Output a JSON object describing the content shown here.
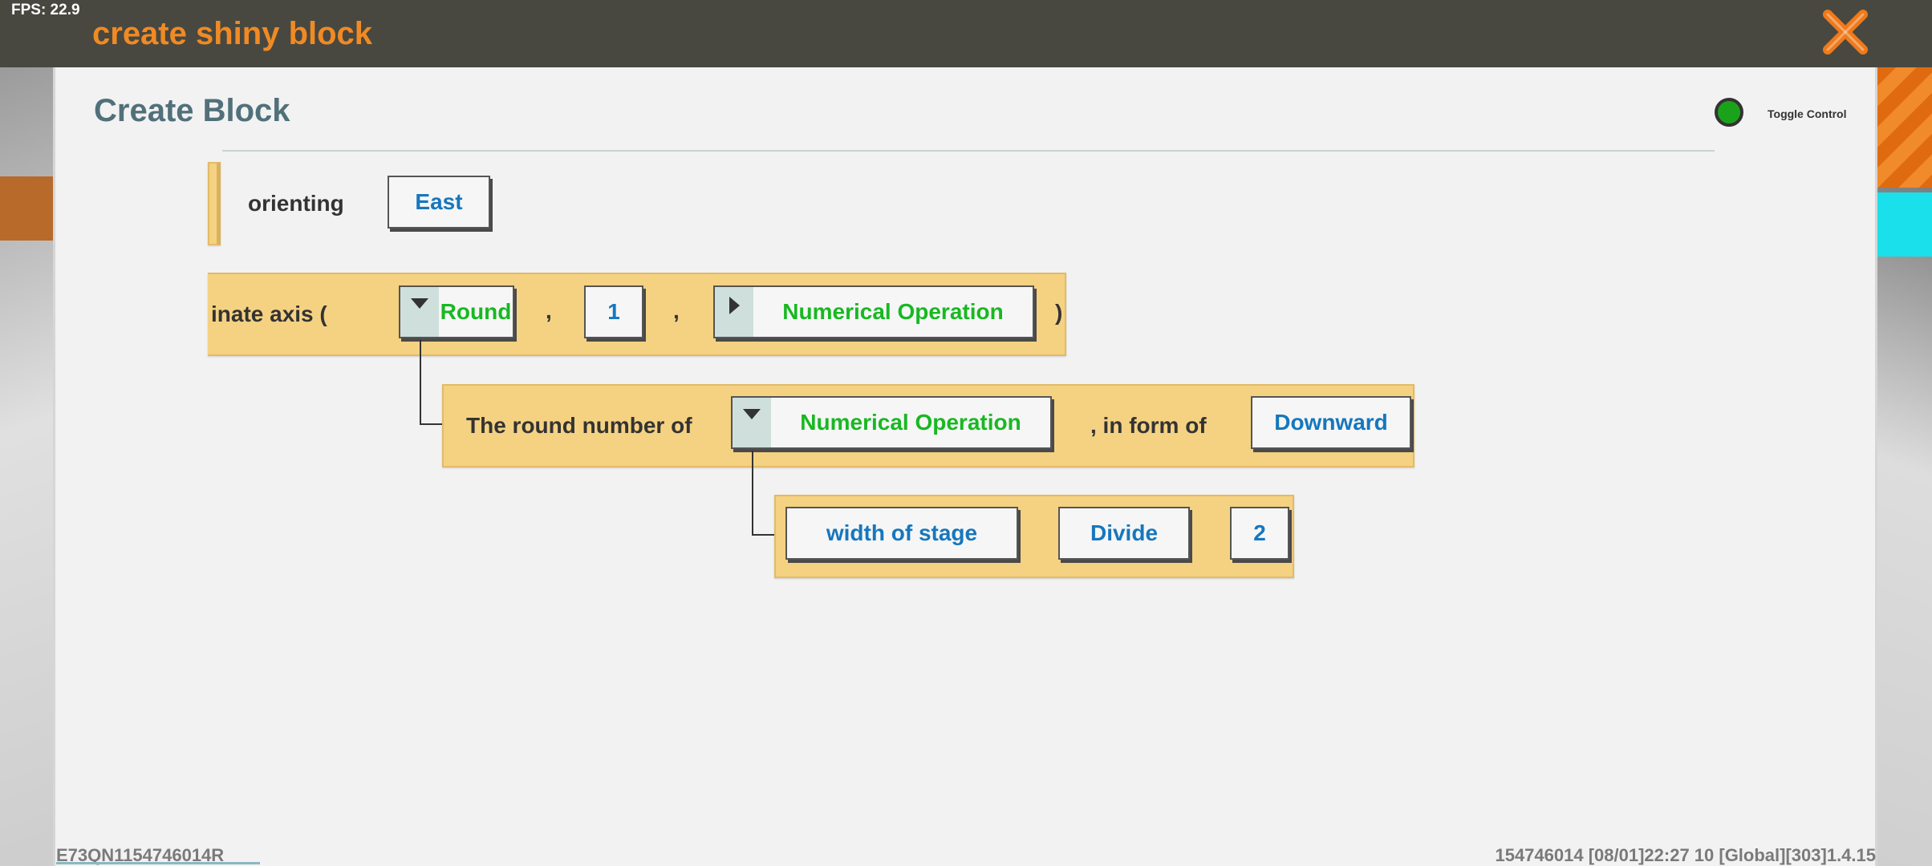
{
  "hud": {
    "fps": "FPS: 22.9"
  },
  "window": {
    "title": "create shiny block"
  },
  "panel": {
    "title": "Create Block",
    "toggle_label": "Toggle Control",
    "toggle_color": "#1aa31a"
  },
  "blocks": {
    "orienting": {
      "label": "orienting",
      "value": "East"
    },
    "coordinate_axis": {
      "label": "inate axis (",
      "func": "Round",
      "comma1": ",",
      "arg": "1",
      "comma2": ",",
      "operation": "Numerical Operation",
      "close_paren": ")"
    },
    "round_number": {
      "label": "The round number of",
      "operation": "Numerical Operation",
      "in_form_label": ", in form of",
      "form": "Downward"
    },
    "division": {
      "operand1": "width of stage",
      "operator": "Divide",
      "operand2": "2"
    }
  },
  "footer": {
    "left": "E73QN1154746014R",
    "right": "154746014   [08/01]22:27 10  [Global][303]1.4.15"
  },
  "colors": {
    "block_fill": "#f5d282",
    "value_text": "#1677bd",
    "operation_text": "#18b822",
    "title_orange": "#f08a24"
  }
}
